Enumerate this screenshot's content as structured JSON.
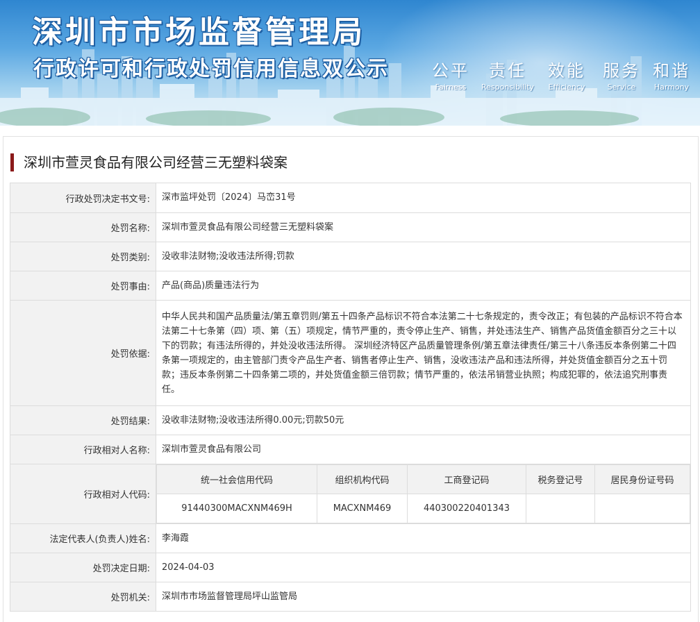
{
  "banner": {
    "title": "深圳市市场监督管理局",
    "subtitle": "行政许可和行政处罚信用信息双公示",
    "slogans": [
      {
        "cn": "公平",
        "en": "Fairness"
      },
      {
        "cn": "责任",
        "en": "Responsibility"
      },
      {
        "cn": "效能",
        "en": "Efficiency"
      },
      {
        "cn": "服务",
        "en": "Service"
      },
      {
        "cn": "和谐",
        "en": "Harmony"
      }
    ]
  },
  "case": {
    "title": "深圳市萱灵食品有限公司经营三无塑料袋案"
  },
  "fields": {
    "doc_no": {
      "label": "行政处罚决定书文号:",
      "value": "深市监坪处罚〔2024〕马峦31号"
    },
    "name": {
      "label": "处罚名称:",
      "value": "深圳市萱灵食品有限公司经营三无塑料袋案"
    },
    "category": {
      "label": "处罚类别:",
      "value": "没收非法财物;没收违法所得;罚款"
    },
    "reason": {
      "label": "处罚事由:",
      "value": "产品(商品)质量违法行为"
    },
    "basis": {
      "label": "处罚依据:",
      "value": "中华人民共和国产品质量法/第五章罚则/第五十四条产品标识不符合本法第二十七条规定的，责令改正；有包装的产品标识不符合本法第二十七条第（四）项、第（五）项规定，情节严重的，责令停止生产、销售，并处违法生产、销售产品货值金额百分之三十以下的罚款；有违法所得的，并处没收违法所得。 深圳经济特区产品质量管理条例/第五章法律责任/第三十八条违反本条例第二十四条第一项规定的，由主管部门责令产品生产者、销售者停止生产、销售，没收违法产品和违法所得，并处货值金额百分之五十罚款；违反本条例第二十四条第二项的，并处货值金额三倍罚款；情节严重的，依法吊销营业执照；构成犯罪的，依法追究刑事责任。"
    },
    "result": {
      "label": "处罚结果:",
      "value": "没收非法财物;没收违法所得0.00元;罚款50元"
    },
    "party": {
      "label": "行政相对人名称:",
      "value": "深圳市萱灵食品有限公司"
    },
    "party_code": {
      "label": "行政相对人代码:",
      "headers": [
        "统一社会信用代码",
        "组织机构代码",
        "工商登记码",
        "税务登记号",
        "居民身份证号码"
      ],
      "values": [
        "91440300MACXNM469H",
        "MACXNM469",
        "440300220401343",
        "",
        ""
      ]
    },
    "legal_rep": {
      "label": "法定代表人(负责人)姓名:",
      "value": "李海霞"
    },
    "date": {
      "label": "处罚决定日期:",
      "value": "2024-04-03"
    },
    "authority": {
      "label": "处罚机关:",
      "value": "深圳市市场监督管理局坪山监管局"
    }
  }
}
